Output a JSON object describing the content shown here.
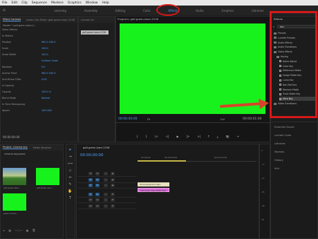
{
  "menubar": [
    "File",
    "Edit",
    "Clip",
    "Sequence",
    "Markers",
    "Graphics",
    "Window",
    "Help"
  ],
  "workspace": {
    "tabs": [
      "Learning",
      "Assembly",
      "Editing",
      "Color",
      "Effects",
      "Audio",
      "Graphics",
      "Libraries"
    ],
    "active": "Effects"
  },
  "effect_controls": {
    "tabs": [
      "Effect Controls",
      "Audio Clip Mixer: golf-green-lawn-2236",
      "Lumetri Sc"
    ],
    "master": "Master * golf-green-lawn-2...",
    "clip": "golf-green-lawn-2236",
    "rows": [
      {
        "label": "Video Effects",
        "value": ""
      },
      {
        "label": "fx  Motion",
        "value": ""
      },
      {
        "label": "Position",
        "value": "960.0   540.0"
      },
      {
        "label": "Scale",
        "value": "100.0"
      },
      {
        "label": "Scale Width",
        "value": "100.0"
      },
      {
        "label": "",
        "value": "Uniform Scale"
      },
      {
        "label": "Rotation",
        "value": "0.0"
      },
      {
        "label": "Anchor Point",
        "value": "960.0   540.0"
      },
      {
        "label": "Anti-flicker Filter",
        "value": "0.00"
      },
      {
        "label": "fx  Opacity",
        "value": ""
      },
      {
        "label": "Opacity",
        "value": "100.0 %"
      },
      {
        "label": "Blend Mode",
        "value": "Normal"
      },
      {
        "label": "fx  Time Remapping",
        "value": ""
      },
      {
        "label": "Speed",
        "value": "100.00%"
      }
    ],
    "timecode": "00:00:00:00"
  },
  "program": {
    "title": "Program: golf-green-lawn-2236",
    "timecode_left": "00:00:00:00",
    "fit": "Fit",
    "quality": "Full",
    "timecode_right": "00:00:01:00",
    "transport": [
      "{",
      "}",
      "|<",
      "<|",
      "▶",
      "|>",
      ">|",
      "⤒",
      "⤓",
      "📷",
      "+"
    ]
  },
  "effects": {
    "title": "Effects",
    "search": "key",
    "items": [
      {
        "label": "Presets",
        "type": "folder",
        "depth": 0
      },
      {
        "label": "Lumetri Presets",
        "type": "folder",
        "depth": 0
      },
      {
        "label": "Audio Effects",
        "type": "folder",
        "depth": 0
      },
      {
        "label": "Audio Transitions",
        "type": "folder",
        "depth": 0
      },
      {
        "label": "Video Effects",
        "type": "folder",
        "depth": 0
      },
      {
        "label": "Keying",
        "type": "folder",
        "depth": 1
      },
      {
        "label": "Alpha Adjust",
        "type": "effect",
        "depth": 2
      },
      {
        "label": "Color Key",
        "type": "effect",
        "depth": 2
      },
      {
        "label": "Difference Matte",
        "type": "effect",
        "depth": 2
      },
      {
        "label": "Image Matte Key",
        "type": "effect",
        "depth": 2
      },
      {
        "label": "Luma Key",
        "type": "effect",
        "depth": 2
      },
      {
        "label": "Non Red Key",
        "type": "effect",
        "depth": 2
      },
      {
        "label": "Remove Matte",
        "type": "effect",
        "depth": 2
      },
      {
        "label": "Track Matte Key",
        "type": "effect",
        "depth": 2
      },
      {
        "label": "Ultra Key",
        "type": "effect",
        "depth": 2,
        "selected": true
      },
      {
        "label": "Video Transitions",
        "type": "folder",
        "depth": 0
      }
    ]
  },
  "lower_right": [
    "Essential Sound",
    "Lumetri Color",
    "Libraries",
    "Markers",
    "History",
    "Info"
  ],
  "project": {
    "tabs": [
      "Project: chroma key",
      "Media Browser"
    ],
    "file": "chroma key.prproj",
    "thumbs": [
      "golf-green-lawn...",
      "golf-green-lawn...",
      "green-screen...",
      ""
    ]
  },
  "timeline": {
    "title": "golf-green-lawn-2236",
    "timecode": "00:00:00:00",
    "ruler": [
      "00:00:00",
      "00:00:05:00",
      "00:00:10:00"
    ],
    "tracks": [
      "V3",
      "V2",
      "V1",
      "A1",
      "A2",
      "A3"
    ],
    "clips": {
      "v2": "chroma-key-bmr.mp4",
      "v1": "golf-green-lawn-2236.mp4"
    },
    "meter_labels": [
      "0",
      "-12",
      "-24",
      "-36",
      "-48",
      "dB"
    ]
  }
}
